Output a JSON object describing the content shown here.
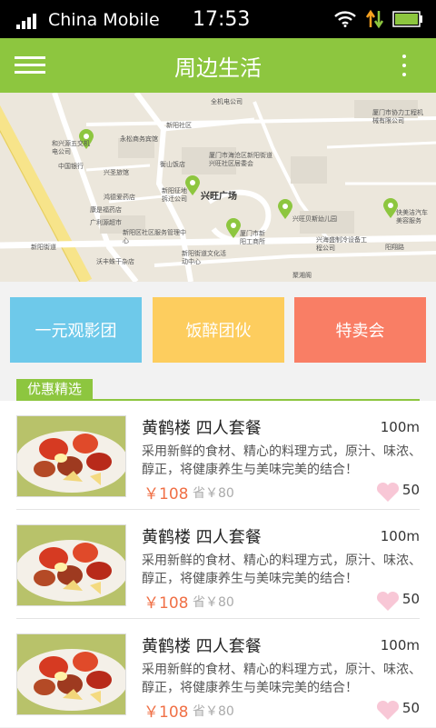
{
  "status_bar": {
    "carrier": "China Mobile",
    "time": "17:53"
  },
  "header": {
    "title": "周边生活"
  },
  "map": {
    "labels": [
      "兴旺广场",
      "永松商务宾馆",
      "中国银行",
      "兴圣旅馆",
      "衡山饭店",
      "鸿德爱药店",
      "康是福药店",
      "广利源超市",
      "新阳区社区服务管理中心",
      "沃丰蛛干杂店",
      "新阳街道文化活动中心",
      "兴旺贝斯幼儿园",
      "厦门市海沧区新阳街道兴旺社区居委会",
      "厦门市机场",
      "兴海盛制冷设备工程公司",
      "快美洁汽车美容服务",
      "厦门市协力工程机械有限公司",
      "新阳社区",
      "新阳街道",
      "新阳路",
      "阳翔路",
      "聚湘阁",
      "和兴源五交机电公司",
      "新阳征地拆迁公司",
      "厦门市新阳工商所",
      "兴旺广场",
      "全机电公司"
    ],
    "accent": "#8dc63f"
  },
  "categories": [
    {
      "label": "一元观影团",
      "color": "#6ec9ea"
    },
    {
      "label": "饭醉团伙",
      "color": "#fdcd5e"
    },
    {
      "label": "特卖会",
      "color": "#f97e65"
    }
  ],
  "deals_section": {
    "title": "优惠精选"
  },
  "deals": [
    {
      "name": "黄鹤楼 四人套餐",
      "distance": "100m",
      "desc": "采用新鲜的食材、精心的料理方式，原汁、味浓、醇正，将健康养生与美味完美的结合！",
      "price": "￥108",
      "save": "省￥80",
      "likes": "50"
    },
    {
      "name": "黄鹤楼 四人套餐",
      "distance": "100m",
      "desc": "采用新鲜的食材、精心的料理方式，原汁、味浓、醇正，将健康养生与美味完美的结合！",
      "price": "￥108",
      "save": "省￥80",
      "likes": "50"
    },
    {
      "name": "黄鹤楼 四人套餐",
      "distance": "100m",
      "desc": "采用新鲜的食材、精心的料理方式，原汁、味浓、醇正，将健康养生与美味完美的结合！",
      "price": "￥108",
      "save": "省￥80",
      "likes": "50"
    }
  ],
  "colors": {
    "header": "#8dc63f",
    "price": "#f07046",
    "heart": "#f8c7d6"
  }
}
